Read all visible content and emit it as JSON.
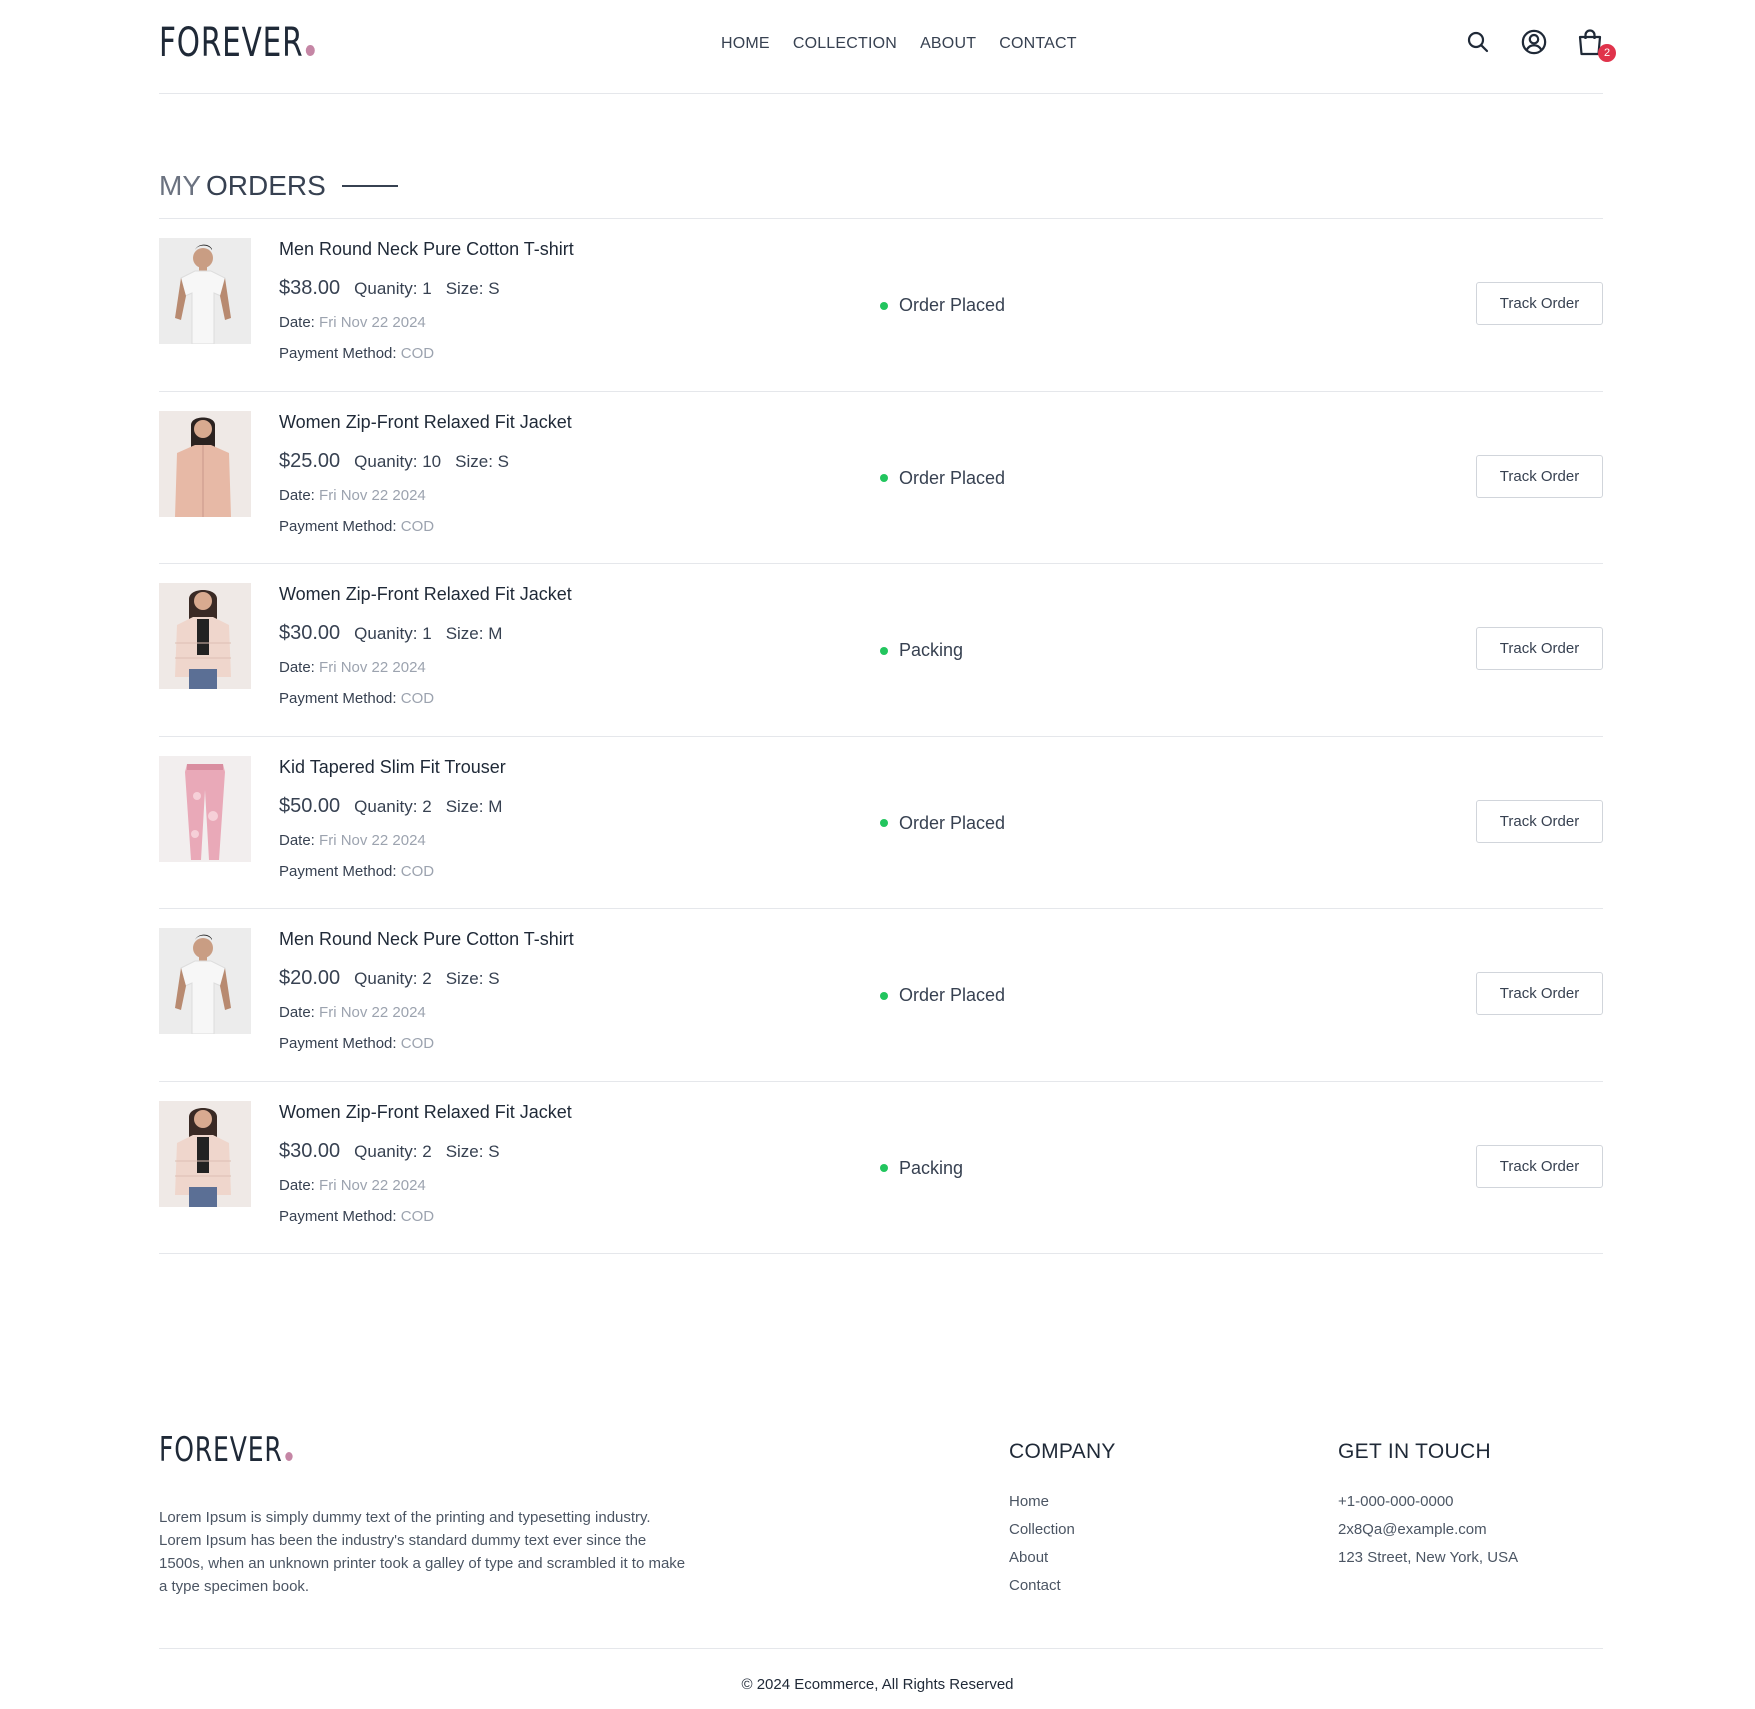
{
  "header": {
    "logo": "FOREVER",
    "nav": [
      "HOME",
      "COLLECTION",
      "ABOUT",
      "CONTACT"
    ],
    "cart_count": "2",
    "icons": [
      "search-icon",
      "profile-icon",
      "cart-icon"
    ]
  },
  "page": {
    "title_light": "MY",
    "title_bold": "ORDERS"
  },
  "labels": {
    "quantity": "Quanity:",
    "size": "Size:",
    "date": "Date:",
    "payment": "Payment Method:",
    "track": "Track Order"
  },
  "orders": [
    {
      "name": "Men Round Neck Pure Cotton T-shirt",
      "price": "$38.00",
      "quantity": "1",
      "size": "S",
      "date": "Fri Nov 22 2024",
      "payment": "COD",
      "status": "Order Placed",
      "image": "man-white-tshirt"
    },
    {
      "name": "Women Zip-Front Relaxed Fit Jacket",
      "price": "$25.00",
      "quantity": "10",
      "size": "S",
      "date": "Fri Nov 22 2024",
      "payment": "COD",
      "status": "Order Placed",
      "image": "woman-pink-jacket"
    },
    {
      "name": "Women Zip-Front Relaxed Fit Jacket",
      "price": "$30.00",
      "quantity": "1",
      "size": "M",
      "date": "Fri Nov 22 2024",
      "payment": "COD",
      "status": "Packing",
      "image": "woman-puffer-jacket"
    },
    {
      "name": "Kid Tapered Slim Fit Trouser",
      "price": "$50.00",
      "quantity": "2",
      "size": "M",
      "date": "Fri Nov 22 2024",
      "payment": "COD",
      "status": "Order Placed",
      "image": "pink-trouser"
    },
    {
      "name": "Men Round Neck Pure Cotton T-shirt",
      "price": "$20.00",
      "quantity": "2",
      "size": "S",
      "date": "Fri Nov 22 2024",
      "payment": "COD",
      "status": "Order Placed",
      "image": "man-white-tshirt"
    },
    {
      "name": "Women Zip-Front Relaxed Fit Jacket",
      "price": "$30.00",
      "quantity": "2",
      "size": "S",
      "date": "Fri Nov 22 2024",
      "payment": "COD",
      "status": "Packing",
      "image": "woman-puffer-jacket"
    }
  ],
  "colors": {
    "status_dot": "#22c55e",
    "logo_dot": "#c586a5",
    "badge": "#e0334b"
  },
  "footer": {
    "logo": "FOREVER",
    "description": "Lorem Ipsum is simply dummy text of the printing and typesetting industry. Lorem Ipsum has been the industry's standard dummy text ever since the 1500s, when an unknown printer took a galley of type and scrambled it to make a type specimen book.",
    "company_heading": "COMPANY",
    "company_links": [
      "Home",
      "Collection",
      "About",
      "Contact"
    ],
    "contact_heading": "GET IN TOUCH",
    "contact_items": [
      "+1-000-000-0000",
      "2x8Qa@example.com",
      "123 Street, New York, USA"
    ],
    "copyright": "© 2024 Ecommerce, All Rights Reserved"
  }
}
